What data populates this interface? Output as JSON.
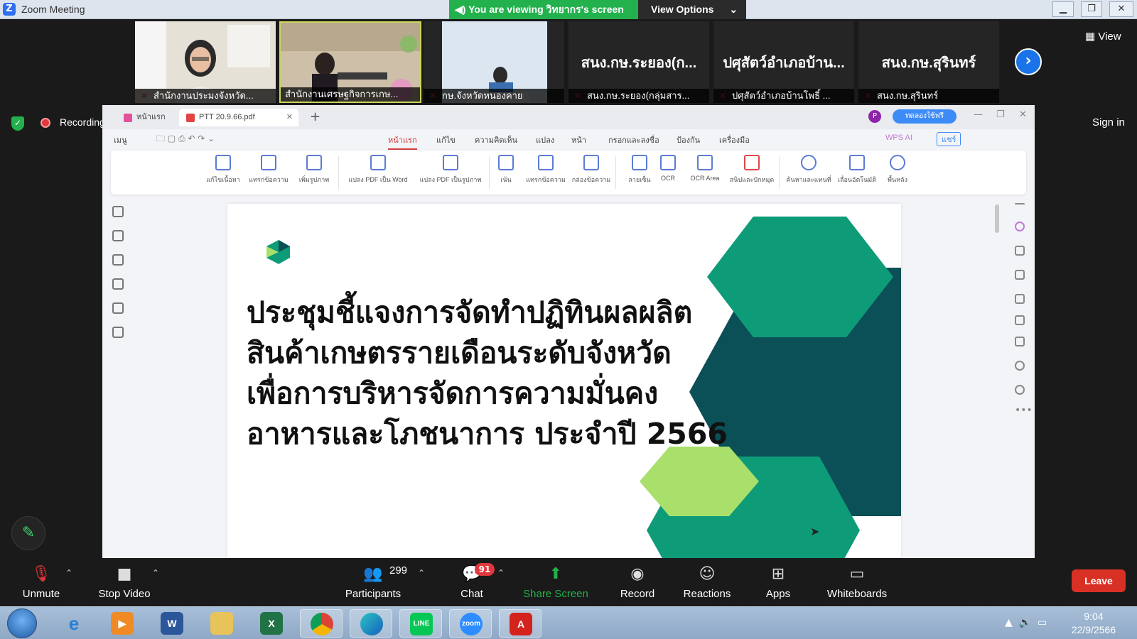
{
  "window": {
    "title": "Zoom Meeting"
  },
  "banner": {
    "viewing": "You are viewing วิทยากร's screen",
    "view_options": "View Options"
  },
  "gallery": {
    "participants": [
      {
        "name": "สำนักงานประมงจังหวัด...",
        "video": true
      },
      {
        "name": "สำนักงานเศรษฐกิจการเกษ...",
        "video": true
      },
      {
        "name": "กษ.จังหวัดหนองคาย",
        "video": true
      },
      {
        "name": "สนง.กษ.ระยอง(กลุ่มสาร...",
        "big_name": "สนง.กษ.ระยอง(ก...",
        "video": false
      },
      {
        "name": "ปศุสัตว์อำเภอบ้านโพธิ์ ...",
        "big_name": "ปศุสัตว์อำเภอบ้าน...",
        "video": false
      },
      {
        "name": "สนง.กษ.สุรินทร์",
        "big_name": "สนง.กษ.สุรินทร์",
        "video": false
      }
    ],
    "view_label": "View"
  },
  "status": {
    "recording": "Recording",
    "sign_in": "Sign in"
  },
  "wps": {
    "tabs": [
      {
        "label": "หน้าแรก"
      },
      {
        "label": "PTT 20.9.66.pdf"
      }
    ],
    "try_button": "ทดลองใช้ฟรี",
    "avatar": "P",
    "menu": [
      "เมนู",
      "หน้าแรก",
      "แก้ไข",
      "ความคิดเห็น",
      "แปลง",
      "หน้า",
      "กรอกและลงชื่อ",
      "ป้องกัน",
      "เครื่องมือ"
    ],
    "wps_ai": "WPS AI",
    "share": "แชร์",
    "ribbon": [
      "แก้ไขเนื้อหา",
      "แทรกข้อความ",
      "เพิ่มรูปภาพ",
      "แปลง PDF เป็น Word",
      "แปลง PDF เป็นรูปภาพ",
      "เน้น",
      "แทรกข้อความ",
      "กล่องข้อความ",
      "ลายเซ็น",
      "OCR",
      "OCR Area",
      "สนิปและปักหมุด",
      "ค้นหาและแทนที่",
      "เลื่อนอัตโนมัติ",
      "พื้นหลัง"
    ]
  },
  "slide": {
    "title_lines": [
      "ประชุมชี้แจงการจัดทำปฏิทินผลผลิต",
      "สินค้าเกษตรรายเดือนระดับจังหวัด",
      "เพื่อการบริหารจัดการความมั่นคง",
      "อาหารและโภชนาการ ประจำปี 2566"
    ],
    "colors": {
      "teal": "#0e9b78",
      "dark": "#0b4f57",
      "lime": "#a8e06b"
    }
  },
  "controls": {
    "unmute": "Unmute",
    "stop_video": "Stop Video",
    "participants": "Participants",
    "participants_count": "299",
    "chat": "Chat",
    "chat_badge": "91",
    "share_screen": "Share Screen",
    "record": "Record",
    "reactions": "Reactions",
    "apps": "Apps",
    "whiteboards": "Whiteboards",
    "leave": "Leave"
  },
  "taskbar": {
    "apps": [
      "internet-explorer",
      "media-player",
      "word",
      "file-explorer",
      "excel",
      "chrome",
      "edge",
      "line",
      "zoom",
      "acrobat"
    ],
    "line_label": "LINE",
    "zoom_label": "zoom",
    "time": "9:04",
    "date": "22/9/2566"
  }
}
